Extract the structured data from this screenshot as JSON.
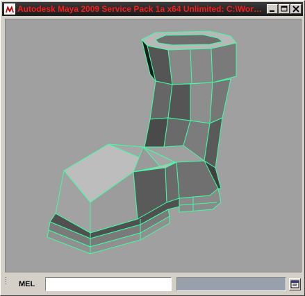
{
  "window": {
    "title": "Autodesk Maya 2009 Service Pack 1a x64 Unlimited: C:\\Work\\...",
    "title_color": "#ff1a1a",
    "icons": {
      "app": "maya-app-icon",
      "minimize": "minimize-icon",
      "maximize": "maximize-icon",
      "close": "close-icon"
    }
  },
  "viewport": {
    "background": "#a0a0a0",
    "wireframe_color": "#3cffa0",
    "object": "boot-mesh"
  },
  "command_line": {
    "label": "MEL",
    "input_value": "",
    "result_text": "",
    "script_editor_icon": "script-editor-icon"
  }
}
